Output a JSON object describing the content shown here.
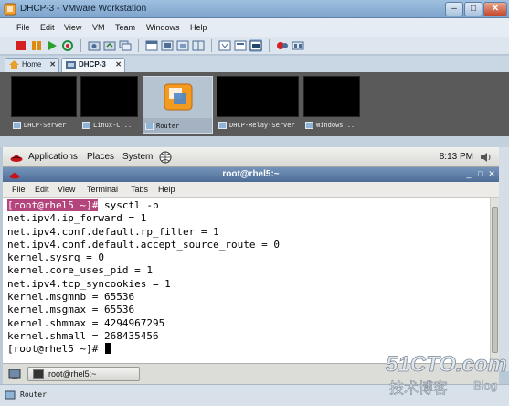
{
  "window": {
    "title": "DHCP-3 - VMware Workstation"
  },
  "menubar": [
    "File",
    "Edit",
    "View",
    "VM",
    "Team",
    "Windows",
    "Help"
  ],
  "tabs": [
    {
      "label": "Home",
      "active": false
    },
    {
      "label": "DHCP-3",
      "active": true
    }
  ],
  "thumbnails": [
    {
      "label": "DHCP-Server",
      "selected": false
    },
    {
      "label": "Linux-C...",
      "selected": false
    },
    {
      "label": "Router",
      "selected": true
    },
    {
      "label": "DHCP-Relay-Server",
      "selected": false
    },
    {
      "label": "Windows...",
      "selected": false
    }
  ],
  "gnome_panel": {
    "applications": "Applications",
    "places": "Places",
    "system": "System",
    "clock": "8:13 PM"
  },
  "terminal": {
    "title": "root@rhel5:~",
    "menu": [
      "File",
      "Edit",
      "View",
      "Terminal",
      "Tabs",
      "Help"
    ],
    "prompt_highlight": "[root@rhel5 ~]#",
    "command": " sysctl -p",
    "output": [
      "net.ipv4.ip_forward = 1",
      "net.ipv4.conf.default.rp_filter = 1",
      "net.ipv4.conf.default.accept_source_route = 0",
      "kernel.sysrq = 0",
      "kernel.core_uses_pid = 1",
      "net.ipv4.tcp_syncookies = 1",
      "kernel.msgmnb = 65536",
      "kernel.msgmax = 65536",
      "kernel.shmmax = 4294967295",
      "kernel.shmall = 268435456"
    ],
    "last_prompt": "[root@rhel5 ~]# "
  },
  "taskbar": {
    "item": "root@rhel5:~"
  },
  "status": {
    "label": "Router"
  },
  "watermark": {
    "brand": "51CTO.com",
    "sub": "技术博客",
    "blog": "Blog"
  }
}
